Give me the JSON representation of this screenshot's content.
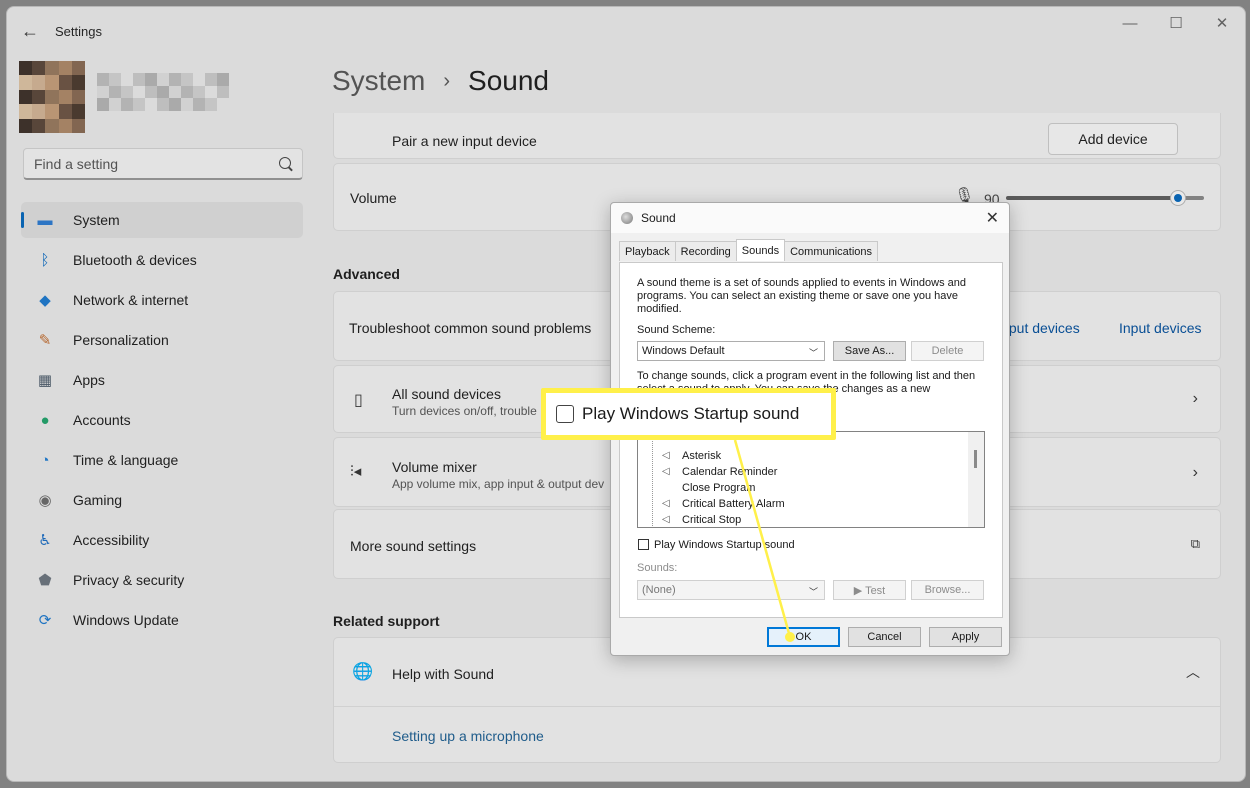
{
  "window": {
    "app_title": "Settings",
    "controls": {
      "minimize": "—",
      "maximize": "☐",
      "close": "✕"
    }
  },
  "search": {
    "placeholder": "Find a setting"
  },
  "nav": {
    "items": [
      {
        "label": "System",
        "icon": "monitor-icon",
        "color": "#2a7bd5",
        "active": true
      },
      {
        "label": "Bluetooth & devices",
        "icon": "bluetooth-icon",
        "color": "#0a6dc7"
      },
      {
        "label": "Network & internet",
        "icon": "wifi-icon",
        "color": "#1a7ad3"
      },
      {
        "label": "Personalization",
        "icon": "brush-icon",
        "color": "#c46a2a"
      },
      {
        "label": "Apps",
        "icon": "apps-icon",
        "color": "#4a5a6a"
      },
      {
        "label": "Accounts",
        "icon": "person-icon",
        "color": "#1ea56b"
      },
      {
        "label": "Time & language",
        "icon": "globe-clock-icon",
        "color": "#1f7fd6"
      },
      {
        "label": "Gaming",
        "icon": "gamepad-icon",
        "color": "#6b6b6b"
      },
      {
        "label": "Accessibility",
        "icon": "accessibility-icon",
        "color": "#1a6fc9"
      },
      {
        "label": "Privacy & security",
        "icon": "shield-icon",
        "color": "#6d7680"
      },
      {
        "label": "Windows Update",
        "icon": "update-icon",
        "color": "#1a7ad3"
      }
    ]
  },
  "breadcrumb": {
    "parent": "System",
    "separator": "›",
    "current": "Sound"
  },
  "main": {
    "pair_input": {
      "label": "Pair a new input device",
      "button": "Add device"
    },
    "volume": {
      "label": "Volume",
      "value": "90",
      "level": 0.9
    },
    "advanced_title": "Advanced",
    "troubleshoot": {
      "label": "Troubleshoot common sound problems",
      "link1": "Output devices",
      "link1_visible": "tput devices",
      "link2": "Input devices"
    },
    "all_devices": {
      "label": "All sound devices",
      "sub": "Turn devices on/off, trouble"
    },
    "mixer": {
      "label": "Volume mixer",
      "sub": "App volume mix, app input & output dev"
    },
    "more_settings": {
      "label": "More sound settings"
    },
    "related_title": "Related support",
    "help": {
      "label": "Help with Sound",
      "link": "Setting up a microphone"
    }
  },
  "dialog": {
    "title": "Sound",
    "close": "✕",
    "tabs": [
      "Playback",
      "Recording",
      "Sounds",
      "Communications"
    ],
    "active_tab": 2,
    "description": "A sound theme is a set of sounds applied to events in Windows and programs. You can select an existing theme or save one you have modified.",
    "scheme_label": "Sound Scheme:",
    "scheme_value": "Windows Default",
    "save_as": "Save As...",
    "delete": "Delete",
    "instructions": "To change sounds, click a program event in the following list and then select a sound to apply. You can save the changes as a new",
    "events": [
      "Asterisk",
      "Calendar Reminder",
      "Close Program",
      "Critical Battery Alarm",
      "Critical Stop"
    ],
    "event_has_sound": [
      true,
      true,
      false,
      true,
      true
    ],
    "startup_checkbox": "Play Windows Startup sound",
    "sounds_label": "Sounds:",
    "sounds_value": "(None)",
    "test": "▶ Test",
    "browse": "Browse...",
    "ok": "OK",
    "cancel": "Cancel",
    "apply": "Apply"
  },
  "callout": {
    "text": "Play Windows Startup sound",
    "border_color": "#fff04a"
  }
}
